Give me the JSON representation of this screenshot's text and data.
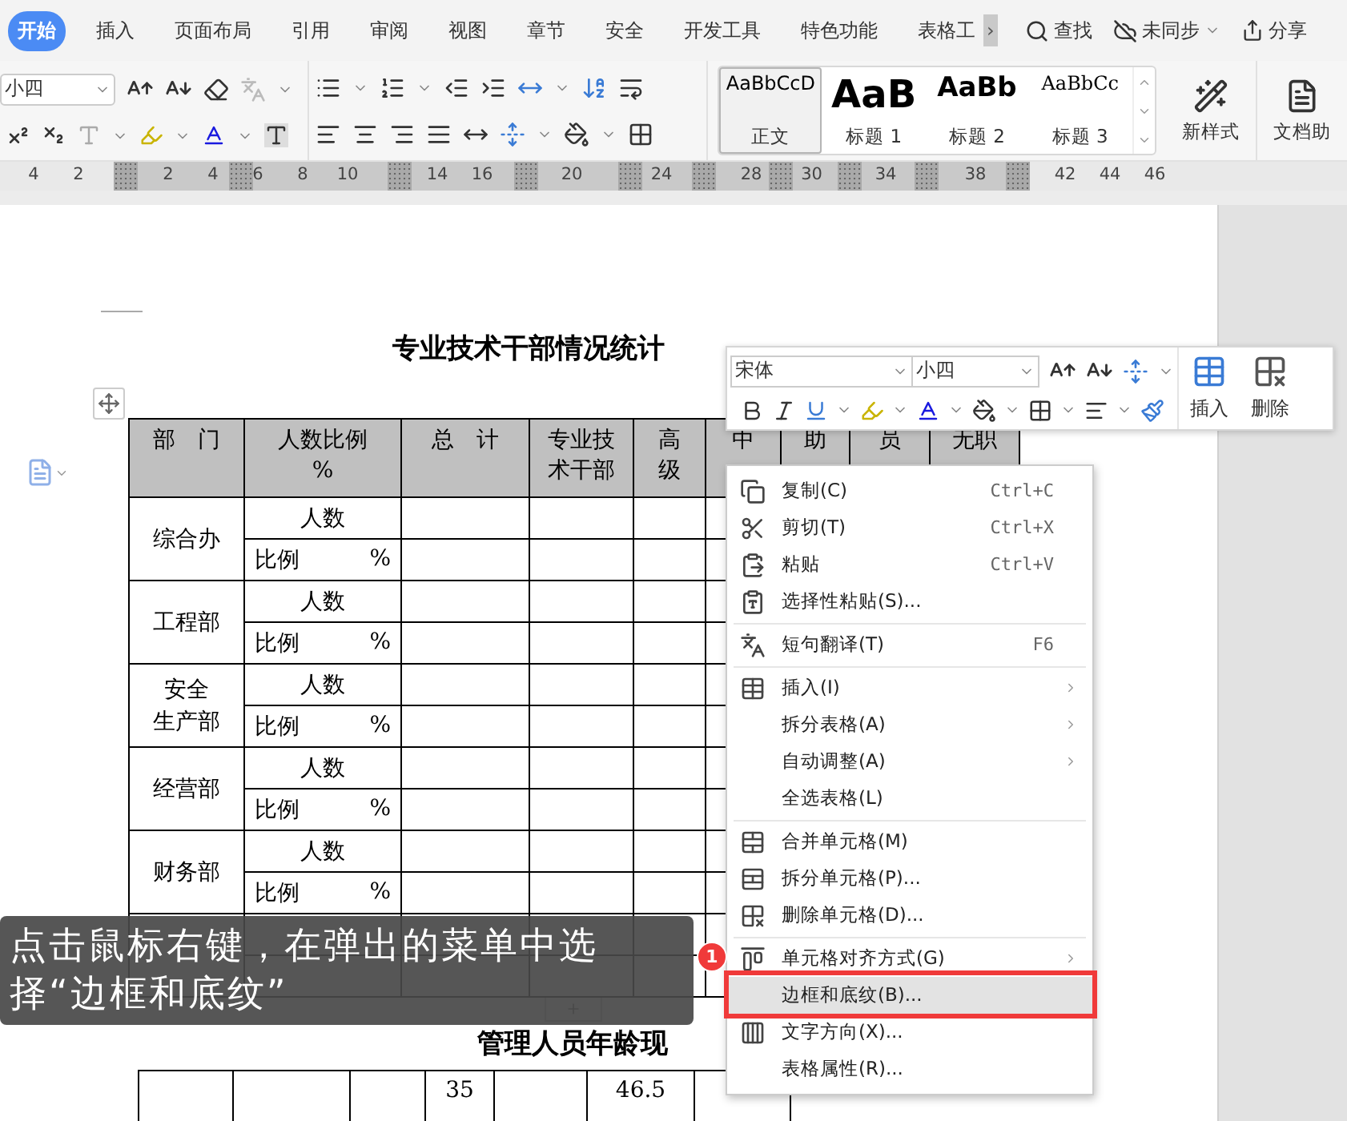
{
  "tabs": [
    {
      "label": "开始",
      "selected": true
    },
    {
      "label": "插入",
      "selected": false
    },
    {
      "label": "页面布局",
      "selected": false
    },
    {
      "label": "引用",
      "selected": false
    },
    {
      "label": "审阅",
      "selected": false
    },
    {
      "label": "视图",
      "selected": false
    },
    {
      "label": "章节",
      "selected": false
    },
    {
      "label": "安全",
      "selected": false
    },
    {
      "label": "开发工具",
      "selected": false
    },
    {
      "label": "特色功能",
      "selected": false
    },
    {
      "label": "表格工",
      "selected": false
    }
  ],
  "tab_scroll": "›",
  "toolbar_right": {
    "search": "查找",
    "sync": "未同步",
    "share": "分享"
  },
  "ribbon": {
    "font_size": "小四",
    "styles": [
      {
        "preview": "AaBbCcD",
        "label": "正文",
        "selected": true,
        "kind": "body"
      },
      {
        "preview": "AaB",
        "label": "标题 1",
        "selected": false,
        "kind": "heading1"
      },
      {
        "preview": "AaBb",
        "label": "标题 2",
        "selected": false,
        "kind": "heading2"
      },
      {
        "preview": "AaBbCc",
        "label": "标题 3",
        "selected": false,
        "kind": "heading3"
      }
    ],
    "new_style": "新样式",
    "doc_assistant": "文档助"
  },
  "ruler": {
    "labels": [
      "4",
      "2",
      "2",
      "4",
      "6",
      "8",
      "10",
      "14",
      "16",
      "20",
      "24",
      "28",
      "30",
      "34",
      "38",
      "42",
      "44",
      "46"
    ]
  },
  "document": {
    "title": "专业技术干部情况统计",
    "table": {
      "columns": [
        {
          "lines": [
            "部　门"
          ]
        },
        {
          "lines": [
            "人数比例",
            "%"
          ]
        },
        {
          "lines": [
            "总　计"
          ]
        },
        {
          "lines": [
            "专业技",
            "术干部"
          ]
        },
        {
          "lines": [
            "高",
            "级"
          ]
        },
        {
          "lines": [
            "中"
          ]
        },
        {
          "lines": [
            "助"
          ]
        },
        {
          "lines": [
            "员"
          ]
        },
        {
          "lines": [
            "无职"
          ]
        }
      ],
      "departments": [
        {
          "lines": [
            "综合办"
          ],
          "rows": [
            {
              "label": "人数"
            },
            {
              "label": "比例",
              "unit": "%"
            }
          ]
        },
        {
          "lines": [
            "工程部"
          ],
          "rows": [
            {
              "label": "人数"
            },
            {
              "label": "比例",
              "unit": "%"
            }
          ]
        },
        {
          "lines": [
            "安全",
            "生产部"
          ],
          "rows": [
            {
              "label": "人数"
            },
            {
              "label": "比例",
              "unit": "%"
            }
          ]
        },
        {
          "lines": [
            "经营部"
          ],
          "rows": [
            {
              "label": "人数"
            },
            {
              "label": "比例",
              "unit": "%"
            }
          ]
        },
        {
          "lines": [
            "财务部"
          ],
          "rows": [
            {
              "label": "人数"
            },
            {
              "label": "比例",
              "unit": "%"
            }
          ]
        }
      ]
    },
    "title_2": "管理人员年龄现",
    "table_2": {
      "values": [
        "35",
        "46.5"
      ]
    }
  },
  "mini_toolbar": {
    "font": "宋体",
    "size": "小四",
    "insert": "插入",
    "delete": "删除"
  },
  "context_menu": {
    "items": [
      {
        "kind": "item",
        "label": "复制(C)",
        "shortcut": "Ctrl+C",
        "submenu": false,
        "selected": false
      },
      {
        "kind": "item",
        "label": "剪切(T)",
        "shortcut": "Ctrl+X",
        "submenu": false,
        "selected": false
      },
      {
        "kind": "item",
        "label": "粘贴",
        "shortcut": "Ctrl+V",
        "submenu": false,
        "selected": false
      },
      {
        "kind": "item",
        "label": "选择性粘贴(S)...",
        "submenu": false,
        "selected": false
      },
      {
        "kind": "separator"
      },
      {
        "kind": "item",
        "label": "短句翻译(T)",
        "shortcut": "F6",
        "submenu": false,
        "selected": false
      },
      {
        "kind": "separator"
      },
      {
        "kind": "item",
        "label": "插入(I)",
        "submenu": true,
        "selected": false
      },
      {
        "kind": "item",
        "label": "拆分表格(A)",
        "submenu": true,
        "selected": false
      },
      {
        "kind": "item",
        "label": "自动调整(A)",
        "submenu": true,
        "selected": false
      },
      {
        "kind": "item",
        "label": "全选表格(L)",
        "submenu": false,
        "selected": false
      },
      {
        "kind": "separator"
      },
      {
        "kind": "item",
        "label": "合并单元格(M)",
        "submenu": false,
        "selected": false
      },
      {
        "kind": "item",
        "label": "拆分单元格(P)...",
        "submenu": false,
        "selected": false
      },
      {
        "kind": "item",
        "label": "删除单元格(D)...",
        "submenu": false,
        "selected": false
      },
      {
        "kind": "separator"
      },
      {
        "kind": "item",
        "label": "单元格对齐方式(G)",
        "submenu": true,
        "selected": false
      },
      {
        "kind": "item",
        "label": "边框和底纹(B)...",
        "submenu": false,
        "selected": true
      },
      {
        "kind": "item",
        "label": "文字方向(X)...",
        "submenu": false,
        "selected": false
      },
      {
        "kind": "item",
        "label": "表格属性(R)...",
        "submenu": false,
        "selected": false
      }
    ]
  },
  "annotation": {
    "badge": "1"
  },
  "caption": "点击鼠标右键，在弹出的菜单中选择“边框和底纹”"
}
